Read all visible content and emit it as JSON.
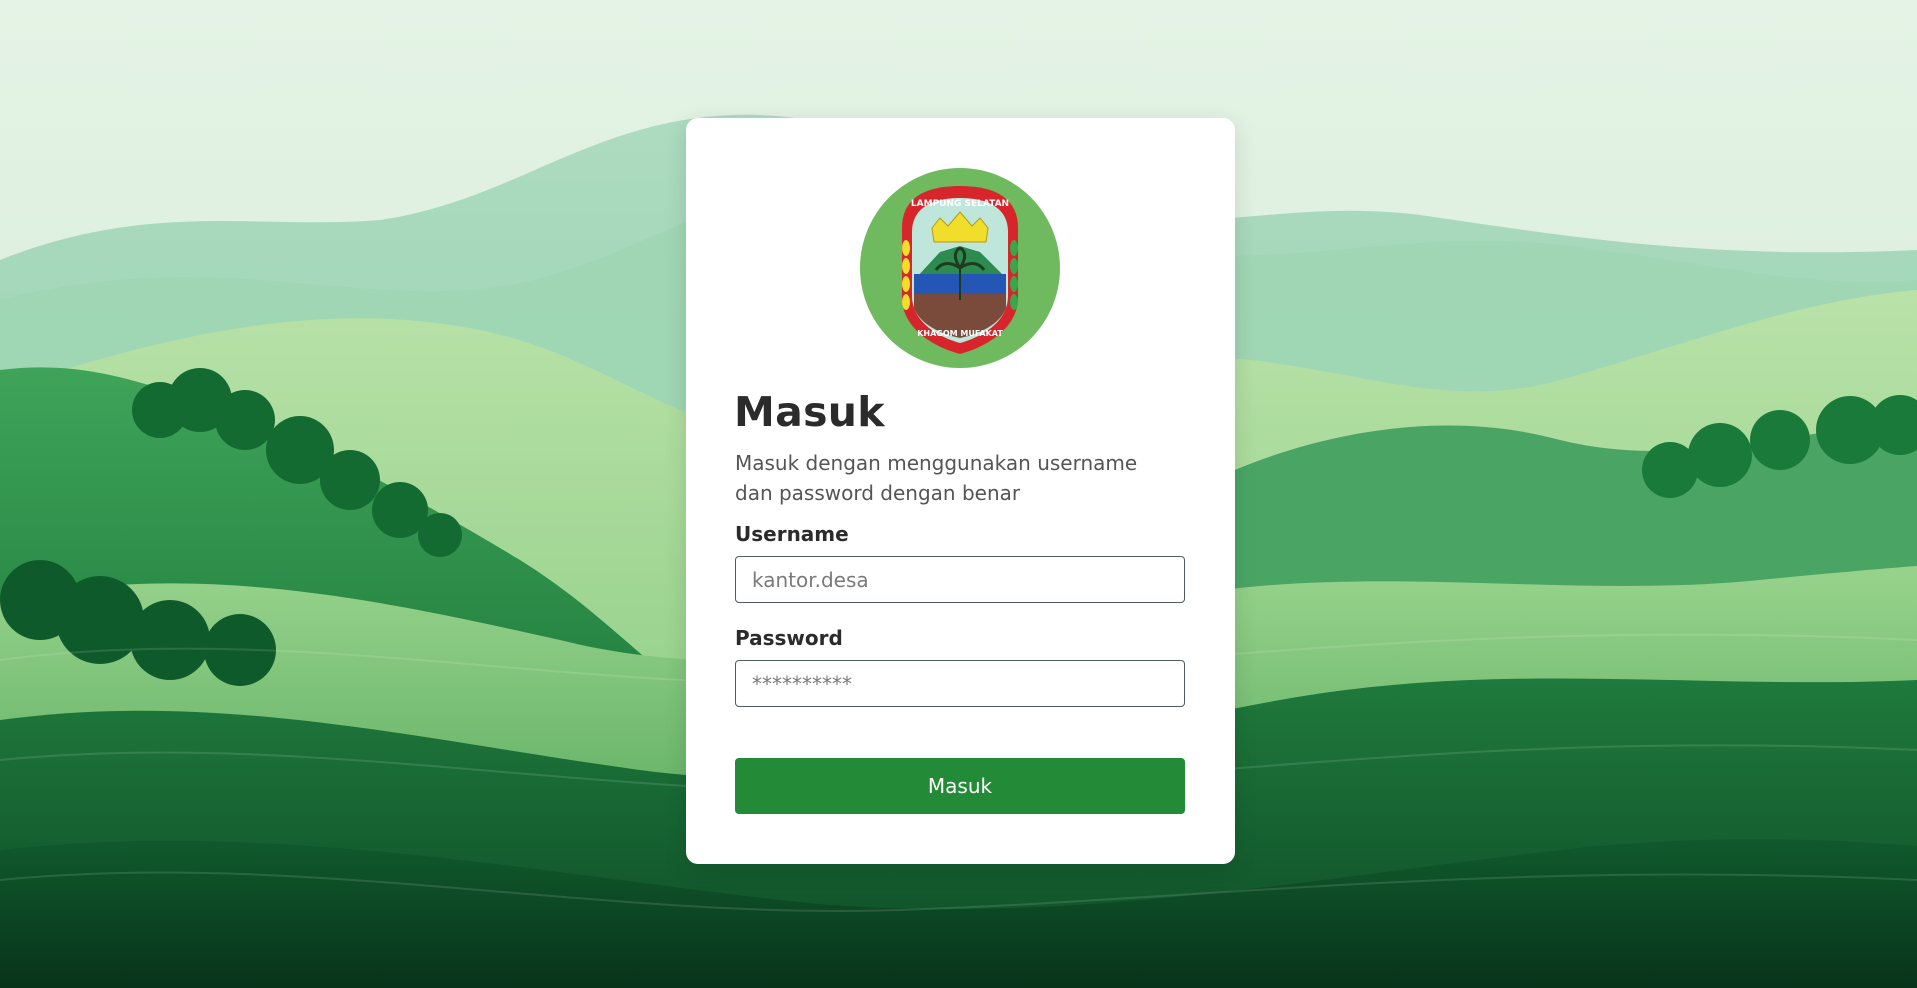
{
  "login": {
    "title": "Masuk",
    "subtitle": "Masuk dengan menggunakan username dan password dengan benar",
    "username_label": "Username",
    "username_placeholder": "kantor.desa",
    "password_label": "Password",
    "password_placeholder": "**********",
    "submit_label": "Masuk"
  },
  "logo": {
    "top_text": "LAMPUNG SELATAN",
    "bottom_text": "KHAGOM MUFAKAT"
  },
  "colors": {
    "accent": "#238a37",
    "logo_circle": "#6fba5f",
    "logo_red": "#d7262b",
    "logo_yellow": "#f1de2a"
  },
  "icons": {
    "background": "green-hills-landscape",
    "logo": "lampung-selatan-emblem"
  }
}
